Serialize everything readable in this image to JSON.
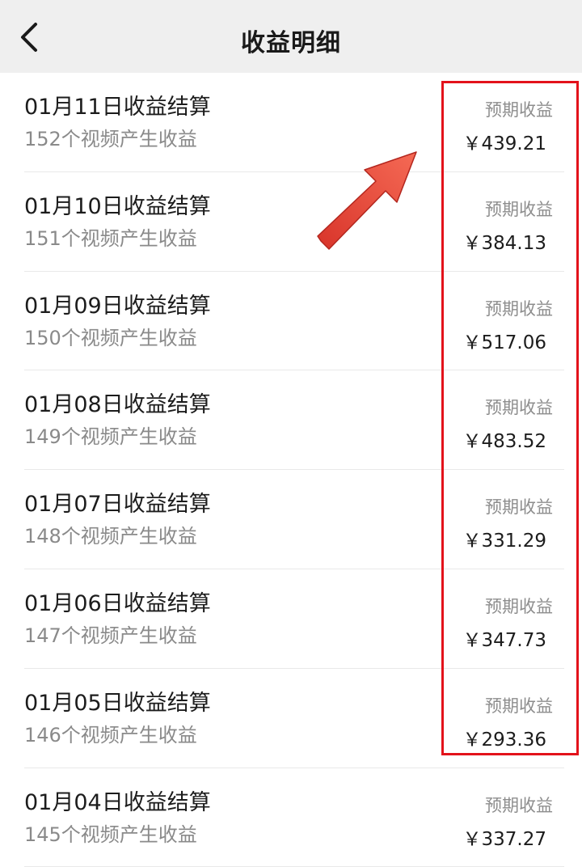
{
  "header": {
    "title": "收益明细",
    "back_icon": "chevron-left-icon"
  },
  "earnings": [
    {
      "title": "01月11日收益结算",
      "subtitle": "152个视频产生收益",
      "label": "预期收益",
      "amount": "￥439.21"
    },
    {
      "title": "01月10日收益结算",
      "subtitle": "151个视频产生收益",
      "label": "预期收益",
      "amount": "￥384.13"
    },
    {
      "title": "01月09日收益结算",
      "subtitle": "150个视频产生收益",
      "label": "预期收益",
      "amount": "￥517.06"
    },
    {
      "title": "01月08日收益结算",
      "subtitle": "149个视频产生收益",
      "label": "预期收益",
      "amount": "￥483.52"
    },
    {
      "title": "01月07日收益结算",
      "subtitle": "148个视频产生收益",
      "label": "预期收益",
      "amount": "￥331.29"
    },
    {
      "title": "01月06日收益结算",
      "subtitle": "147个视频产生收益",
      "label": "预期收益",
      "amount": "￥347.73"
    },
    {
      "title": "01月05日收益结算",
      "subtitle": "146个视频产生收益",
      "label": "预期收益",
      "amount": "￥293.36"
    },
    {
      "title": "01月04日收益结算",
      "subtitle": "145个视频产生收益",
      "label": "预期收益",
      "amount": "￥337.27"
    }
  ],
  "colors": {
    "navbar_bg": "#efefef",
    "highlight": "#e3121b",
    "arrow": "#ef4a3c"
  }
}
